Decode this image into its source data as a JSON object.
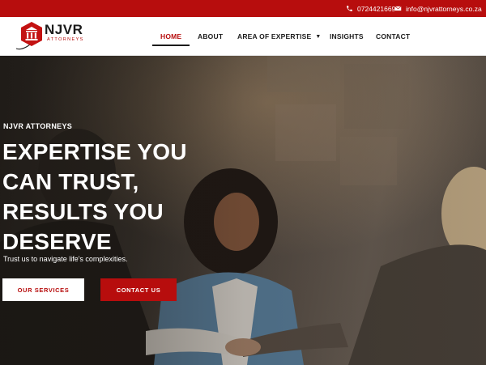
{
  "topbar": {
    "phone": "0724421669",
    "email": "info@njvrattorneys.co.za",
    "phone_icon": "phone-icon",
    "email_icon": "envelope-icon"
  },
  "brand": {
    "name": "NJVR",
    "tagline": "ATTORNEYS"
  },
  "nav": {
    "items": [
      {
        "label": "HOME",
        "active": true
      },
      {
        "label": "ABOUT",
        "active": false
      },
      {
        "label": "AREA OF EXPERTISE",
        "active": false,
        "has_dropdown": true
      },
      {
        "label": "INSIGHTS",
        "active": false
      },
      {
        "label": "CONTACT",
        "active": false
      }
    ]
  },
  "hero": {
    "eyebrow": "NJVR ATTORNEYS",
    "title_lines": [
      "EXPERTISE YOU",
      "CAN TRUST,",
      "RESULTS YOU",
      "DESERVE"
    ],
    "subtitle": "Trust us to navigate life's complexities.",
    "primary_button": "OUR SERVICES",
    "secondary_button": "CONTACT US"
  },
  "colors": {
    "brand_red": "#b70d0d",
    "text_dark": "#1b1b1b",
    "white": "#ffffff"
  }
}
